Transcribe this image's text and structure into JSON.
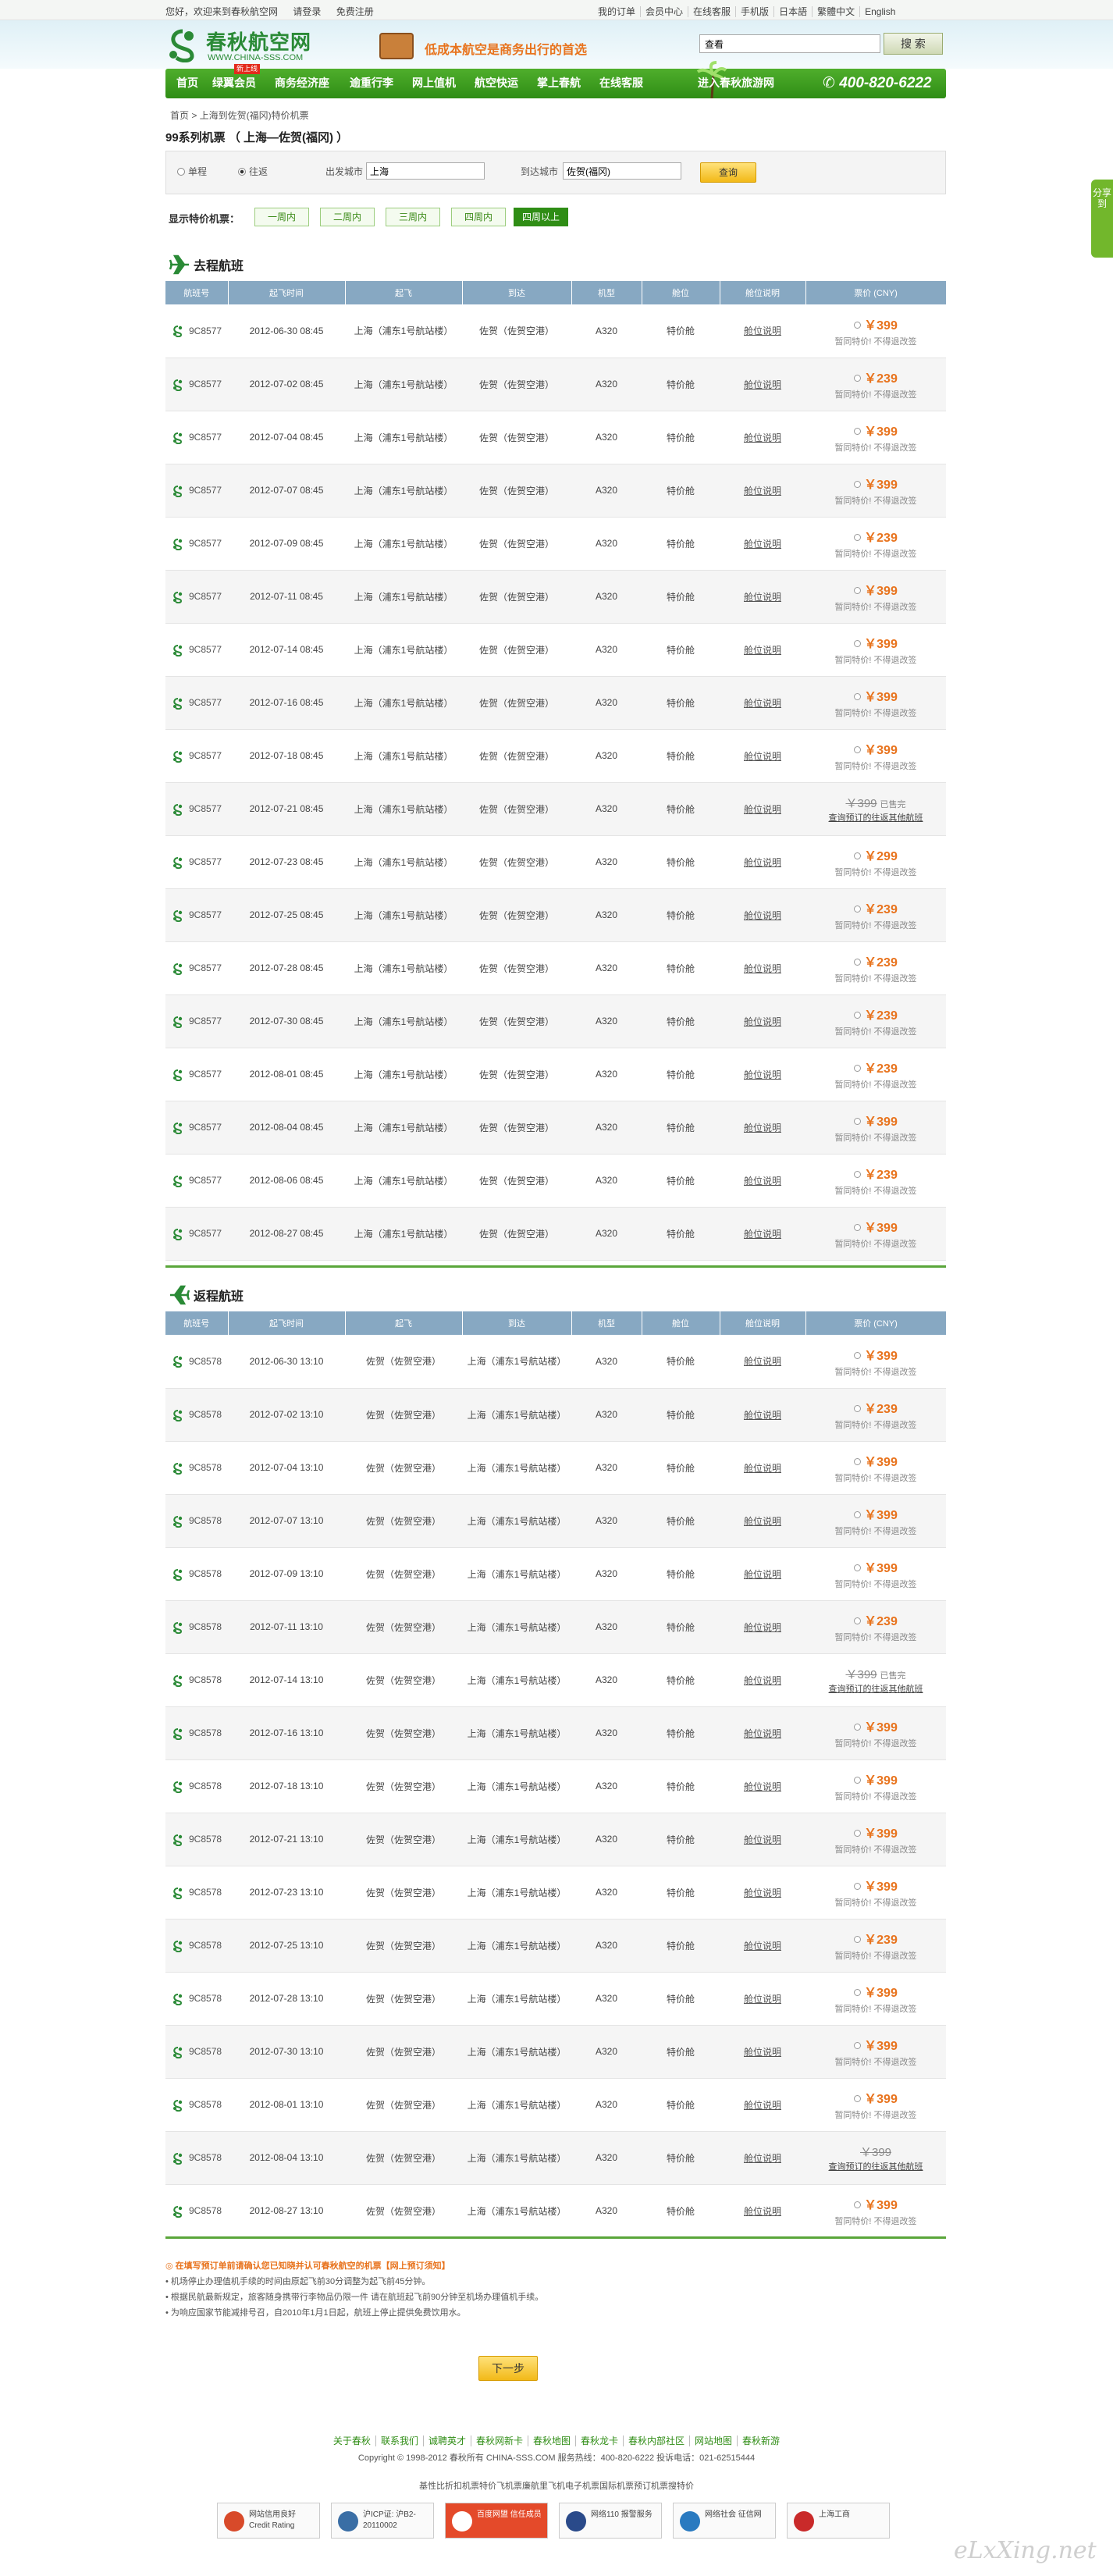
{
  "topbar": {
    "welcome": "您好，欢迎来到春秋航空网",
    "login": "请登录",
    "register": "免费注册",
    "links": [
      "我的订单",
      "会员中心",
      "在线客服",
      "手机版",
      "日本語",
      "繁體中文",
      "English"
    ]
  },
  "header": {
    "logo_cn": "春秋航空网",
    "logo_en": "WWW.CHINA-SSS.COM",
    "slogan": "低成本航空是商务出行的首选",
    "search_value": "查看",
    "search_button": "搜 索"
  },
  "nav": {
    "items": [
      "首页",
      "绿翼会员",
      "商务经济座",
      "逾重行李",
      "网上值机",
      "航空快运",
      "掌上春航",
      "在线客服"
    ],
    "badge": "新上线",
    "special": "进入春秋旅游网",
    "phone": "400-820-6222"
  },
  "share": "分享到",
  "breadcrumb": "首页 > 上海到佐贺(福冈)特价机票",
  "page_title": "99系列机票 （ 上海—佐贺(福冈) ）",
  "form": {
    "oneway": "单程",
    "roundtrip": "往返",
    "from_label": "出发城市",
    "from_value": "上海",
    "to_label": "到达城市",
    "to_value": "佐贺(福冈)",
    "query": "查询"
  },
  "filter": {
    "label": "显示特价机票：",
    "weeks": [
      "一周内",
      "二周内",
      "三周内",
      "四周内",
      "四周以上"
    ]
  },
  "headers": [
    "航班号",
    "起飞时间",
    "起飞",
    "到达",
    "机型",
    "舱位",
    "舱位说明",
    "票价 (CNY)"
  ],
  "outbound": {
    "title": "去程航班",
    "rows": [
      {
        "no": "9C8577",
        "date": "2012-06-30 08:45",
        "from": "上海（浦东1号航站楼）",
        "to": "佐贺（佐贺空港）",
        "plane": "A320",
        "cabin": "特价舱",
        "rule": "舱位说明",
        "price": "￥399",
        "note": "暂同特价! 不得退改签"
      },
      {
        "no": "9C8577",
        "date": "2012-07-02 08:45",
        "from": "上海（浦东1号航站楼）",
        "to": "佐贺（佐贺空港）",
        "plane": "A320",
        "cabin": "特价舱",
        "rule": "舱位说明",
        "price": "￥239",
        "note": "暂同特价! 不得退改签"
      },
      {
        "no": "9C8577",
        "date": "2012-07-04 08:45",
        "from": "上海（浦东1号航站楼）",
        "to": "佐贺（佐贺空港）",
        "plane": "A320",
        "cabin": "特价舱",
        "rule": "舱位说明",
        "price": "￥399",
        "note": "暂同特价! 不得退改签"
      },
      {
        "no": "9C8577",
        "date": "2012-07-07 08:45",
        "from": "上海（浦东1号航站楼）",
        "to": "佐贺（佐贺空港）",
        "plane": "A320",
        "cabin": "特价舱",
        "rule": "舱位说明",
        "price": "￥399",
        "note": "暂同特价! 不得退改签"
      },
      {
        "no": "9C8577",
        "date": "2012-07-09 08:45",
        "from": "上海（浦东1号航站楼）",
        "to": "佐贺（佐贺空港）",
        "plane": "A320",
        "cabin": "特价舱",
        "rule": "舱位说明",
        "price": "￥239",
        "note": "暂同特价! 不得退改签"
      },
      {
        "no": "9C8577",
        "date": "2012-07-11 08:45",
        "from": "上海（浦东1号航站楼）",
        "to": "佐贺（佐贺空港）",
        "plane": "A320",
        "cabin": "特价舱",
        "rule": "舱位说明",
        "price": "￥399",
        "note": "暂同特价! 不得退改签"
      },
      {
        "no": "9C8577",
        "date": "2012-07-14 08:45",
        "from": "上海（浦东1号航站楼）",
        "to": "佐贺（佐贺空港）",
        "plane": "A320",
        "cabin": "特价舱",
        "rule": "舱位说明",
        "price": "￥399",
        "note": "暂同特价! 不得退改签"
      },
      {
        "no": "9C8577",
        "date": "2012-07-16 08:45",
        "from": "上海（浦东1号航站楼）",
        "to": "佐贺（佐贺空港）",
        "plane": "A320",
        "cabin": "特价舱",
        "rule": "舱位说明",
        "price": "￥399",
        "note": "暂同特价! 不得退改签"
      },
      {
        "no": "9C8577",
        "date": "2012-07-18 08:45",
        "from": "上海（浦东1号航站楼）",
        "to": "佐贺（佐贺空港）",
        "plane": "A320",
        "cabin": "特价舱",
        "rule": "舱位说明",
        "price": "￥399",
        "note": "暂同特价! 不得退改签"
      },
      {
        "no": "9C8577",
        "date": "2012-07-21 08:45",
        "from": "上海（浦东1号航站楼）",
        "to": "佐贺（佐贺空港）",
        "plane": "A320",
        "cabin": "特价舱",
        "rule": "舱位说明",
        "soldout": "￥399",
        "soldout_tag": "已售完",
        "soldout_note": "查询预订的往返其他航班"
      },
      {
        "no": "9C8577",
        "date": "2012-07-23 08:45",
        "from": "上海（浦东1号航站楼）",
        "to": "佐贺（佐贺空港）",
        "plane": "A320",
        "cabin": "特价舱",
        "rule": "舱位说明",
        "price": "￥299",
        "note": "暂同特价! 不得退改签"
      },
      {
        "no": "9C8577",
        "date": "2012-07-25 08:45",
        "from": "上海（浦东1号航站楼）",
        "to": "佐贺（佐贺空港）",
        "plane": "A320",
        "cabin": "特价舱",
        "rule": "舱位说明",
        "price": "￥239",
        "note": "暂同特价! 不得退改签"
      },
      {
        "no": "9C8577",
        "date": "2012-07-28 08:45",
        "from": "上海（浦东1号航站楼）",
        "to": "佐贺（佐贺空港）",
        "plane": "A320",
        "cabin": "特价舱",
        "rule": "舱位说明",
        "price": "￥239",
        "note": "暂同特价! 不得退改签"
      },
      {
        "no": "9C8577",
        "date": "2012-07-30 08:45",
        "from": "上海（浦东1号航站楼）",
        "to": "佐贺（佐贺空港）",
        "plane": "A320",
        "cabin": "特价舱",
        "rule": "舱位说明",
        "price": "￥239",
        "note": "暂同特价! 不得退改签"
      },
      {
        "no": "9C8577",
        "date": "2012-08-01 08:45",
        "from": "上海（浦东1号航站楼）",
        "to": "佐贺（佐贺空港）",
        "plane": "A320",
        "cabin": "特价舱",
        "rule": "舱位说明",
        "price": "￥239",
        "note": "暂同特价! 不得退改签"
      },
      {
        "no": "9C8577",
        "date": "2012-08-04 08:45",
        "from": "上海（浦东1号航站楼）",
        "to": "佐贺（佐贺空港）",
        "plane": "A320",
        "cabin": "特价舱",
        "rule": "舱位说明",
        "price": "￥399",
        "note": "暂同特价! 不得退改签"
      },
      {
        "no": "9C8577",
        "date": "2012-08-06 08:45",
        "from": "上海（浦东1号航站楼）",
        "to": "佐贺（佐贺空港）",
        "plane": "A320",
        "cabin": "特价舱",
        "rule": "舱位说明",
        "price": "￥239",
        "note": "暂同特价! 不得退改签"
      },
      {
        "no": "9C8577",
        "date": "2012-08-27 08:45",
        "from": "上海（浦东1号航站楼）",
        "to": "佐贺（佐贺空港）",
        "plane": "A320",
        "cabin": "特价舱",
        "rule": "舱位说明",
        "price": "￥399",
        "note": "暂同特价! 不得退改签"
      }
    ]
  },
  "return": {
    "title": "返程航班",
    "rows": [
      {
        "no": "9C8578",
        "date": "2012-06-30 13:10",
        "from": "佐贺（佐贺空港）",
        "to": "上海（浦东1号航站楼）",
        "plane": "A320",
        "cabin": "特价舱",
        "rule": "舱位说明",
        "price": "￥399",
        "note": "暂同特价! 不得退改签"
      },
      {
        "no": "9C8578",
        "date": "2012-07-02 13:10",
        "from": "佐贺（佐贺空港）",
        "to": "上海（浦东1号航站楼）",
        "plane": "A320",
        "cabin": "特价舱",
        "rule": "舱位说明",
        "price": "￥239",
        "note": "暂同特价! 不得退改签"
      },
      {
        "no": "9C8578",
        "date": "2012-07-04 13:10",
        "from": "佐贺（佐贺空港）",
        "to": "上海（浦东1号航站楼）",
        "plane": "A320",
        "cabin": "特价舱",
        "rule": "舱位说明",
        "price": "￥399",
        "note": "暂同特价! 不得退改签"
      },
      {
        "no": "9C8578",
        "date": "2012-07-07 13:10",
        "from": "佐贺（佐贺空港）",
        "to": "上海（浦东1号航站楼）",
        "plane": "A320",
        "cabin": "特价舱",
        "rule": "舱位说明",
        "price": "￥399",
        "note": "暂同特价! 不得退改签"
      },
      {
        "no": "9C8578",
        "date": "2012-07-09 13:10",
        "from": "佐贺（佐贺空港）",
        "to": "上海（浦东1号航站楼）",
        "plane": "A320",
        "cabin": "特价舱",
        "rule": "舱位说明",
        "price": "￥399",
        "note": "暂同特价! 不得退改签"
      },
      {
        "no": "9C8578",
        "date": "2012-07-11 13:10",
        "from": "佐贺（佐贺空港）",
        "to": "上海（浦东1号航站楼）",
        "plane": "A320",
        "cabin": "特价舱",
        "rule": "舱位说明",
        "price": "￥239",
        "note": "暂同特价! 不得退改签"
      },
      {
        "no": "9C8578",
        "date": "2012-07-14 13:10",
        "from": "佐贺（佐贺空港）",
        "to": "上海（浦东1号航站楼）",
        "plane": "A320",
        "cabin": "特价舱",
        "rule": "舱位说明",
        "soldout": "￥399",
        "soldout_tag": "已售完",
        "soldout_note": "查询预订的往返其他航班"
      },
      {
        "no": "9C8578",
        "date": "2012-07-16 13:10",
        "from": "佐贺（佐贺空港）",
        "to": "上海（浦东1号航站楼）",
        "plane": "A320",
        "cabin": "特价舱",
        "rule": "舱位说明",
        "price": "￥399",
        "note": "暂同特价! 不得退改签"
      },
      {
        "no": "9C8578",
        "date": "2012-07-18 13:10",
        "from": "佐贺（佐贺空港）",
        "to": "上海（浦东1号航站楼）",
        "plane": "A320",
        "cabin": "特价舱",
        "rule": "舱位说明",
        "price": "￥399",
        "note": "暂同特价! 不得退改签"
      },
      {
        "no": "9C8578",
        "date": "2012-07-21 13:10",
        "from": "佐贺（佐贺空港）",
        "to": "上海（浦东1号航站楼）",
        "plane": "A320",
        "cabin": "特价舱",
        "rule": "舱位说明",
        "price": "￥399",
        "note": "暂同特价! 不得退改签"
      },
      {
        "no": "9C8578",
        "date": "2012-07-23 13:10",
        "from": "佐贺（佐贺空港）",
        "to": "上海（浦东1号航站楼）",
        "plane": "A320",
        "cabin": "特价舱",
        "rule": "舱位说明",
        "price": "￥399",
        "note": "暂同特价! 不得退改签"
      },
      {
        "no": "9C8578",
        "date": "2012-07-25 13:10",
        "from": "佐贺（佐贺空港）",
        "to": "上海（浦东1号航站楼）",
        "plane": "A320",
        "cabin": "特价舱",
        "rule": "舱位说明",
        "price": "￥239",
        "note": "暂同特价! 不得退改签"
      },
      {
        "no": "9C8578",
        "date": "2012-07-28 13:10",
        "from": "佐贺（佐贺空港）",
        "to": "上海（浦东1号航站楼）",
        "plane": "A320",
        "cabin": "特价舱",
        "rule": "舱位说明",
        "price": "￥399",
        "note": "暂同特价! 不得退改签"
      },
      {
        "no": "9C8578",
        "date": "2012-07-30 13:10",
        "from": "佐贺（佐贺空港）",
        "to": "上海（浦东1号航站楼）",
        "plane": "A320",
        "cabin": "特价舱",
        "rule": "舱位说明",
        "price": "￥399",
        "note": "暂同特价! 不得退改签"
      },
      {
        "no": "9C8578",
        "date": "2012-08-01 13:10",
        "from": "佐贺（佐贺空港）",
        "to": "上海（浦东1号航站楼）",
        "plane": "A320",
        "cabin": "特价舱",
        "rule": "舱位说明",
        "price": "￥399",
        "note": "暂同特价! 不得退改签"
      },
      {
        "no": "9C8578",
        "date": "2012-08-04 13:10",
        "from": "佐贺（佐贺空港）",
        "to": "上海（浦东1号航站楼）",
        "plane": "A320",
        "cabin": "特价舱",
        "rule": "舱位说明",
        "soldout": "￥399",
        "soldout_tag": "",
        "soldout_note": "查询预订的往返其他航班"
      },
      {
        "no": "9C8578",
        "date": "2012-08-27 13:10",
        "from": "佐贺（佐贺空港）",
        "to": "上海（浦东1号航站楼）",
        "plane": "A320",
        "cabin": "特价舱",
        "rule": "舱位说明",
        "price": "￥399",
        "note": "暂同特价! 不得退改签"
      }
    ]
  },
  "notes": {
    "warning": "◎ 在填写预订单前请确认您已知晓并认可春秋航空的机票【网上预订须知】",
    "lines": [
      "• 机场停止办理值机手续的时间由原起飞前30分调整为起飞前45分钟。",
      "• 根据民航最新规定，旅客随身携带行李物品仍限一件 请在航班起飞前90分钟至机场办理值机手续。",
      "• 为响应国家节能减排号召，自2010年1月1日起，航班上停止提供免费饮用水。"
    ]
  },
  "next_button": "下一步",
  "footer": {
    "links": [
      "关于春秋",
      "联系我们",
      "诚聘英才",
      "春秋网新卡",
      "春秋地图",
      "春秋龙卡",
      "春秋内部社区",
      "网站地图",
      "春秋新游"
    ],
    "copyright": "Copyright © 1998-2012 春秋所有 CHINA-SSS.COM    服务热线：400-820-6222    投诉电话：021-62515444",
    "keywords": "基性比折扣机票特价飞机票廉航里飞机电子机票国际机票预订机票搜特价",
    "badges": [
      "网站信用良好 Credit Rating",
      "沪ICP证: 沪B2-20110002",
      "百度网盟 信任成员",
      "网络110 报警服务",
      "网络社会 征信网",
      "上海工商"
    ]
  },
  "watermark": "eLxXing.net"
}
